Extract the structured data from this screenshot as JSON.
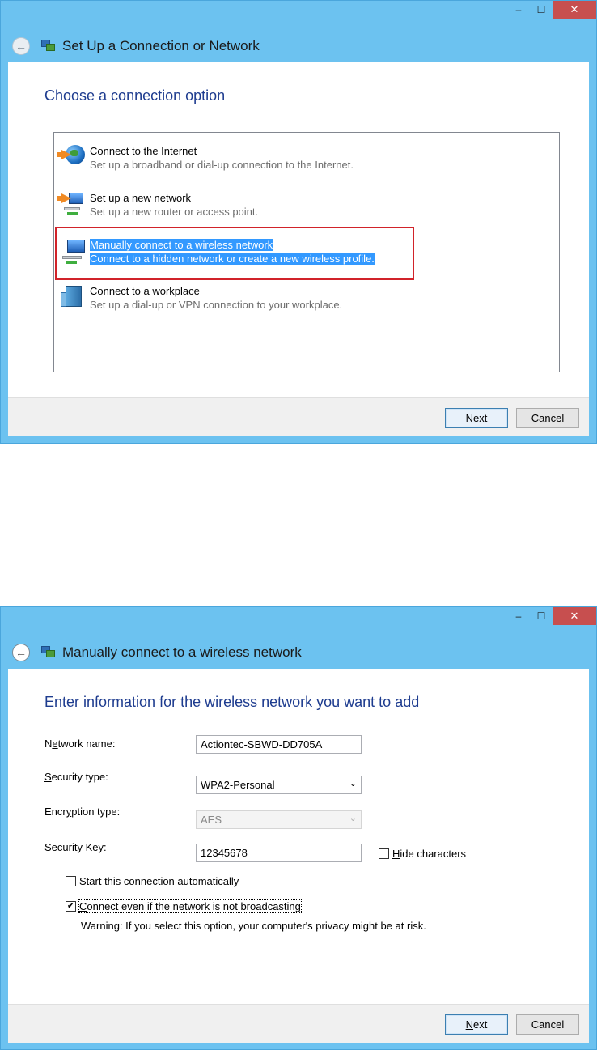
{
  "window1": {
    "caption": {
      "minimize": "–",
      "maximize": "☐",
      "close": "✕"
    },
    "title": "Set Up a Connection or Network",
    "heading": "Choose a connection option",
    "options": [
      {
        "title": "Connect to the Internet",
        "desc": "Set up a broadband or dial-up connection to the Internet.",
        "icon": "globe-icon"
      },
      {
        "title": "Set up a new network",
        "desc": "Set up a new router or access point.",
        "icon": "router-icon"
      },
      {
        "title": "Manually connect to a wireless network",
        "desc": "Connect to a hidden network or create a new wireless profile.",
        "icon": "wireless-icon"
      },
      {
        "title": "Connect to a workplace",
        "desc": "Set up a dial-up or VPN connection to your workplace.",
        "icon": "workplace-icon"
      }
    ],
    "selected_index": 2,
    "highlight_color": "#d1232a",
    "buttons": {
      "next_prefix": "",
      "next_mnemonic": "N",
      "next_rest": "ext",
      "cancel": "Cancel"
    }
  },
  "window2": {
    "caption": {
      "minimize": "–",
      "maximize": "☐",
      "close": "✕"
    },
    "title": "Manually connect to a wireless network",
    "heading": "Enter information for the wireless network you want to add",
    "fields": {
      "network_name": {
        "label_pre": "N",
        "label_mnemonic": "e",
        "label_post": "twork name:",
        "value": "Actiontec-SBWD-DD705A"
      },
      "security_type": {
        "label_pre": "",
        "label_mnemonic": "S",
        "label_post": "ecurity type:",
        "value": "WPA2-Personal"
      },
      "encryption_type": {
        "label_pre": "Encr",
        "label_mnemonic": "y",
        "label_post": "ption type:",
        "value": "AES"
      },
      "security_key": {
        "label_pre": "Se",
        "label_mnemonic": "c",
        "label_post": "urity Key:",
        "value": "12345678"
      }
    },
    "hide_characters": {
      "mnemonic": "H",
      "rest": "ide characters",
      "checked": false
    },
    "start_auto": {
      "mnemonic": "S",
      "rest": "tart this connection automatically",
      "checked": false
    },
    "connect_even": {
      "mnemonic": "C",
      "rest": "onnect even if the network is not broadcasting",
      "checked": true
    },
    "warning": "Warning: If you select this option, your computer's privacy might be at risk.",
    "buttons": {
      "next_mnemonic": "N",
      "next_rest": "ext",
      "cancel": "Cancel"
    }
  },
  "colors": {
    "title_bar": "#6cc2f0",
    "heading_blue": "#1e3c8f",
    "selection_blue": "#3399ff"
  }
}
